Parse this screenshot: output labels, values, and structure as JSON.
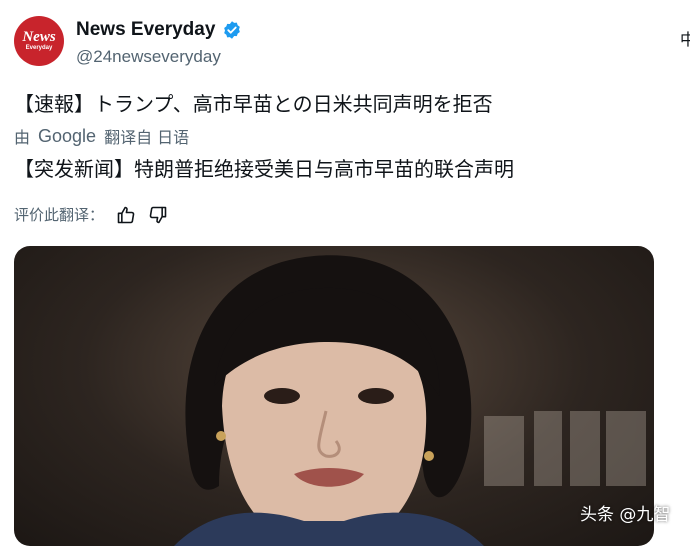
{
  "account": {
    "avatar_big": "News",
    "avatar_small": "Everyday",
    "name": "News Everyday",
    "handle": "@24newseveryday",
    "corner_text": "中"
  },
  "tweet": {
    "text": "【速報】トランプ、高市早苗との日米共同声明を拒否"
  },
  "translation": {
    "prefix": "由",
    "engine": "Google",
    "translated_from": "翻译自 日语",
    "text": "【突发新闻】特朗普拒绝接受美日与高市早苗的联合声明",
    "rate_label": "评价此翻译："
  },
  "media": {
    "watermark": "头条 @九智"
  },
  "colors": {
    "avatar_red": "#c8242c",
    "verified_blue": "#1d9bf0",
    "muted_text": "#536471"
  }
}
